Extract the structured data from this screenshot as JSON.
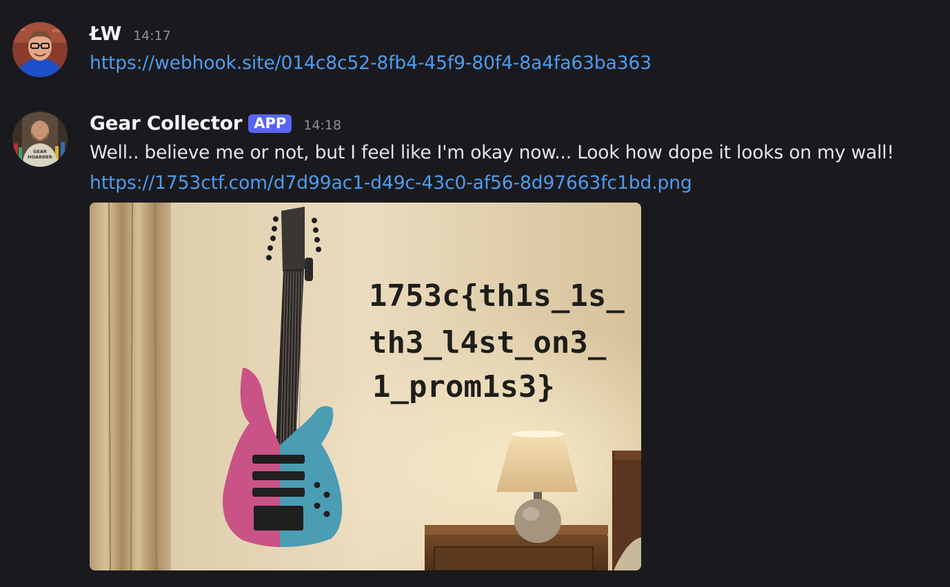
{
  "messages": [
    {
      "author": "ŁW",
      "timestamp": "14:17",
      "link": "https://webhook.site/014c8c52-8fb4-45f9-80f4-8a4fa63ba363",
      "avatar_icon": "user-photo-avatar"
    },
    {
      "author": "Gear Collector",
      "badge": "APP",
      "timestamp": "14:18",
      "text": "Well.. believe me or not, but I feel like I'm okay now... Look how dope it looks on my wall!",
      "link": "https://1753ctf.com/d7d99ac1-d49c-43c0-af56-8d97663fc1bd.png",
      "avatar_icon": "bot-photo-avatar",
      "avatar_shirt_text": [
        "GEAR",
        "HOARDER"
      ],
      "image": {
        "wall_text": [
          "1753c{th1s_1s_",
          "th3_l4st_on3_",
          "1_prom1s3}"
        ]
      }
    }
  ],
  "colors": {
    "background": "#1a1a1e",
    "link": "#4f9cf0",
    "badge": "#5865f2",
    "timestamp": "#8e9297"
  }
}
